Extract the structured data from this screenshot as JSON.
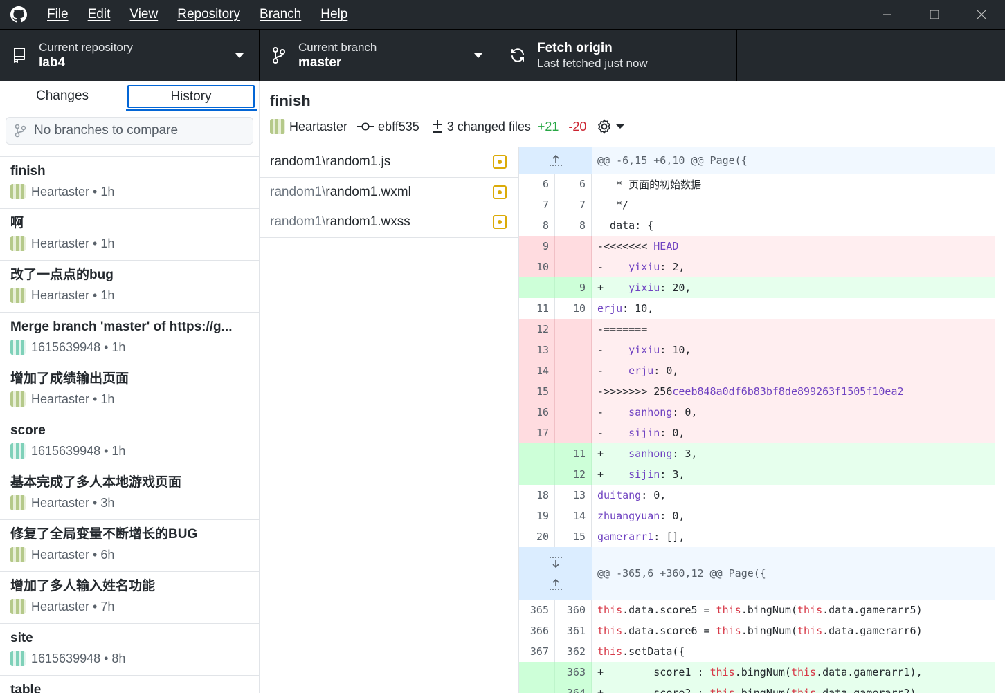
{
  "menu": [
    "File",
    "Edit",
    "View",
    "Repository",
    "Branch",
    "Help"
  ],
  "toolbar": {
    "repo_label": "Current repository",
    "repo_value": "lab4",
    "branch_label": "Current branch",
    "branch_value": "master",
    "fetch_label": "Fetch origin",
    "fetch_value": "Last fetched just now"
  },
  "tabs": {
    "changes": "Changes",
    "history": "History"
  },
  "compare_placeholder": "No branches to compare",
  "commits": [
    {
      "title": "finish",
      "author": "Heartaster",
      "time": "1h",
      "avatar": "green"
    },
    {
      "title": "啊",
      "author": "Heartaster",
      "time": "1h",
      "avatar": "green"
    },
    {
      "title": "改了一点点的bug",
      "author": "Heartaster",
      "time": "1h",
      "avatar": "green"
    },
    {
      "title": "Merge branch 'master' of https://g...",
      "author": "1615639948",
      "time": "1h",
      "avatar": "teal"
    },
    {
      "title": "增加了成绩输出页面",
      "author": "Heartaster",
      "time": "1h",
      "avatar": "green"
    },
    {
      "title": "score",
      "author": "1615639948",
      "time": "1h",
      "avatar": "teal"
    },
    {
      "title": "基本完成了多人本地游戏页面",
      "author": "Heartaster",
      "time": "3h",
      "avatar": "green"
    },
    {
      "title": "修复了全局变量不断增长的BUG",
      "author": "Heartaster",
      "time": "6h",
      "avatar": "green"
    },
    {
      "title": "增加了多人输入姓名功能",
      "author": "Heartaster",
      "time": "7h",
      "avatar": "green"
    },
    {
      "title": "site",
      "author": "1615639948",
      "time": "8h",
      "avatar": "teal"
    },
    {
      "title": "table",
      "author": "",
      "time": "",
      "avatar": ""
    }
  ],
  "selected_commit": {
    "summary": "finish",
    "author": "Heartaster",
    "sha": "ebff535",
    "changed_files": "3 changed files",
    "additions": "+21",
    "deletions": "-20"
  },
  "files": [
    {
      "dir": "random1\\",
      "name": "random1.js"
    },
    {
      "dir": "random1\\",
      "name": "random1.wxml"
    },
    {
      "dir": "random1\\",
      "name": "random1.wxss"
    }
  ],
  "diff": {
    "hunk1": "@@ -6,15 +6,10 @@ Page({",
    "hunk2": "@@ -365,6 +360,12 @@ Page({",
    "lines": [
      {
        "type": "ctx",
        "old": "6",
        "new": "6",
        "text": "   * 页面的初始数据"
      },
      {
        "type": "ctx",
        "old": "7",
        "new": "7",
        "text": "   */"
      },
      {
        "type": "ctx",
        "old": "8",
        "new": "8",
        "text": "  data: {"
      },
      {
        "type": "del",
        "old": "9",
        "new": "",
        "text": "-<<<<<<< HEAD"
      },
      {
        "type": "del",
        "old": "10",
        "new": "",
        "text": "-    yixiu: 2,"
      },
      {
        "type": "add",
        "old": "",
        "new": "9",
        "text": "+    yixiu: 20,"
      },
      {
        "type": "ctx",
        "old": "11",
        "new": "10",
        "text": "     erju: 10,"
      },
      {
        "type": "del",
        "old": "12",
        "new": "",
        "text": "-======="
      },
      {
        "type": "del",
        "old": "13",
        "new": "",
        "text": "-    yixiu: 10,"
      },
      {
        "type": "del",
        "old": "14",
        "new": "",
        "text": "-    erju: 0,"
      },
      {
        "type": "del",
        "old": "15",
        "new": "",
        "text": "->>>>>>> 256ceeb848a0df6b83bf8de899263f1505f10ea2"
      },
      {
        "type": "del",
        "old": "16",
        "new": "",
        "text": "-    sanhong: 0,"
      },
      {
        "type": "del",
        "old": "17",
        "new": "",
        "text": "-    sijin: 0,"
      },
      {
        "type": "add",
        "old": "",
        "new": "11",
        "text": "+    sanhong: 3,"
      },
      {
        "type": "add",
        "old": "",
        "new": "12",
        "text": "+    sijin: 3,"
      },
      {
        "type": "ctx",
        "old": "18",
        "new": "13",
        "text": "     duitang: 0,"
      },
      {
        "type": "ctx",
        "old": "19",
        "new": "14",
        "text": "     zhuangyuan: 0,"
      },
      {
        "type": "ctx",
        "old": "20",
        "new": "15",
        "text": "     gamerarr1: [],"
      }
    ],
    "lines2": [
      {
        "type": "ctx",
        "old": "365",
        "new": "360",
        "text": "       this.data.score5 = this.bingNum(this.data.gamerarr5)"
      },
      {
        "type": "ctx",
        "old": "366",
        "new": "361",
        "text": "       this.data.score6 = this.bingNum(this.data.gamerarr6)"
      },
      {
        "type": "ctx",
        "old": "367",
        "new": "362",
        "text": "       this.setData({"
      },
      {
        "type": "add",
        "old": "",
        "new": "363",
        "text": "+        score1 : this.bingNum(this.data.gamerarr1),"
      },
      {
        "type": "add",
        "old": "",
        "new": "364",
        "text": "+        score2 : this.bingNum(this.data.gamerarr2),"
      }
    ]
  },
  "colors": {
    "accent": "#0366d6",
    "add": "#28a745",
    "del": "#cb2431",
    "modified": "#dbab09",
    "titlebar": "#24292e"
  }
}
